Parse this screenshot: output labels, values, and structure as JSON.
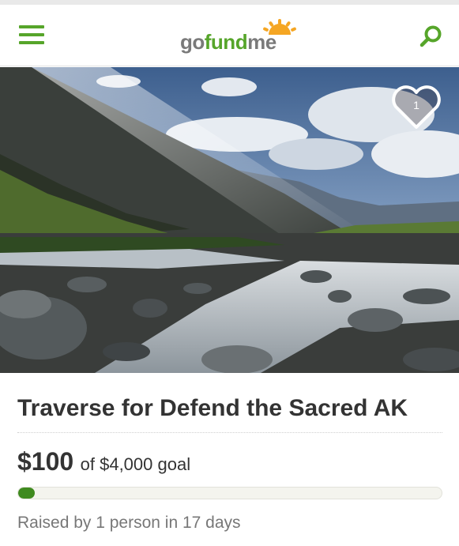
{
  "app": {
    "logo": {
      "part1": "go",
      "part2": "fund",
      "part3": "me"
    },
    "colors": {
      "brand_green": "#56a52a",
      "progress_green": "#3f8a1f",
      "sun": "#f5a623"
    }
  },
  "header": {
    "menu_icon": "hamburger-icon",
    "search_icon": "search-icon"
  },
  "hero": {
    "heart_icon": "heart-icon",
    "heart_count": "1"
  },
  "campaign": {
    "title": "Traverse for Defend the Sacred AK",
    "raised": "$100",
    "goal_text": "of $4,000 goal",
    "progress_fraction": 0.025,
    "raised_by": "Raised by 1 person in 17 days"
  }
}
